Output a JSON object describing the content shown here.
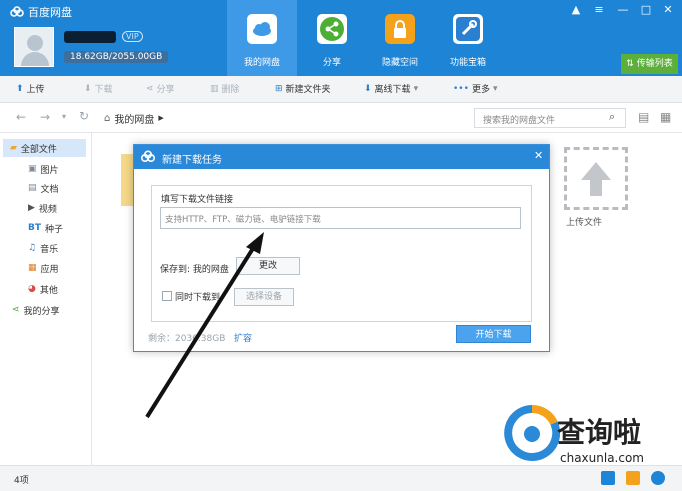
{
  "app": {
    "title": "百度网盘"
  },
  "user": {
    "vip_badge": "VIP",
    "quota": "18.62GB/2055.00GB"
  },
  "main_tabs": [
    {
      "label": "我的网盘"
    },
    {
      "label": "分享"
    },
    {
      "label": "隐藏空间"
    },
    {
      "label": "功能宝箱"
    }
  ],
  "transfer_list": "传输列表",
  "toolbar": {
    "upload": "上传",
    "download": "下载",
    "share": "分享",
    "delete": "删除",
    "new_folder": "新建文件夹",
    "offline_download": "离线下载",
    "more": "更多"
  },
  "address": {
    "path": "我的网盘",
    "search_placeholder": "搜索我的网盘文件"
  },
  "sidebar": {
    "items": [
      {
        "label": "全部文件"
      },
      {
        "label": "图片"
      },
      {
        "label": "文档"
      },
      {
        "label": "视频"
      },
      {
        "label": "种子",
        "prefix": "BT"
      },
      {
        "label": "音乐"
      },
      {
        "label": "应用"
      },
      {
        "label": "其他"
      },
      {
        "label": "我的分享"
      }
    ]
  },
  "content": {
    "upload_label": "上传文件"
  },
  "dialog": {
    "title": "新建下载任务",
    "link_label": "填写下载文件链接",
    "link_placeholder": "支持HTTP、FTP、磁力链、电驴链接下载",
    "save_to_label": "保存到: 我的网盘",
    "change_button": "更改",
    "simultaneous_label": "同时下载到",
    "choose_device_button": "选择设备",
    "remaining_label": "剩余：2036.38GB",
    "expand_label": "扩容",
    "start_button": "开始下载"
  },
  "statusbar": {
    "count": "4项"
  },
  "watermark": {
    "title": "查询啦",
    "sub": "chaxunla.com"
  },
  "colors": {
    "brand": "#1d84d6",
    "accent": "#4ba3ee",
    "green": "#5daf3c"
  }
}
